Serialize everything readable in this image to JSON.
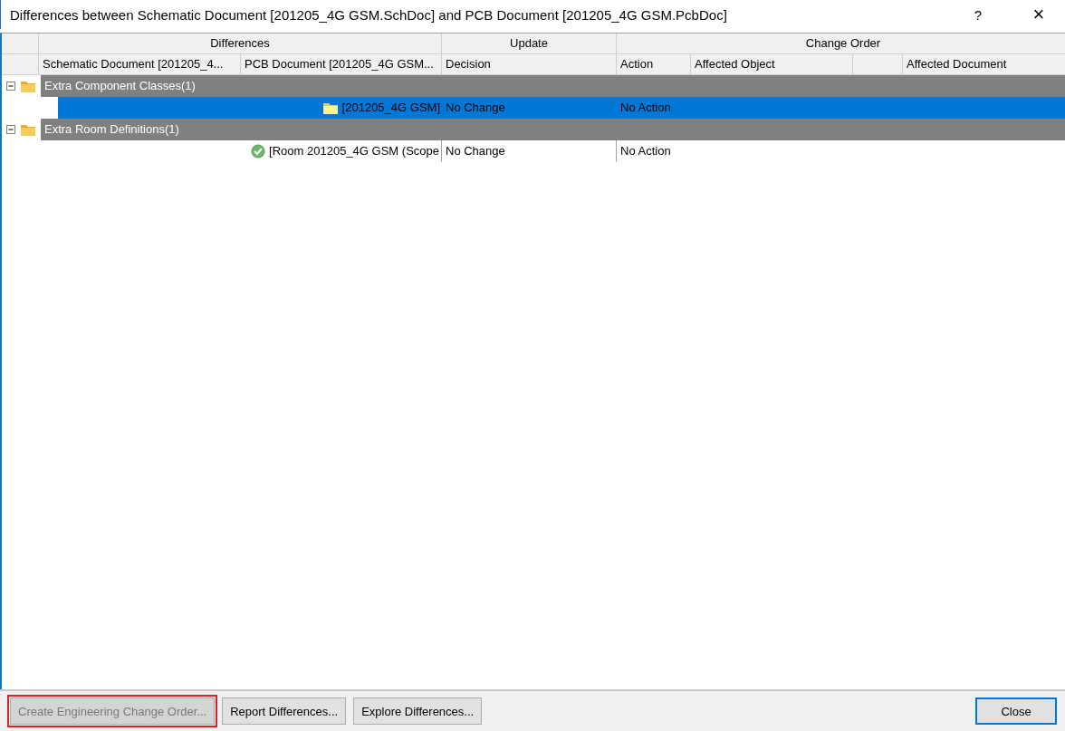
{
  "window": {
    "title": "Differences between Schematic Document [201205_4G GSM.SchDoc] and PCB Document [201205_4G GSM.PcbDoc]",
    "help": "?",
    "close": "×"
  },
  "table": {
    "column_groups": [
      {
        "label": "Differences"
      },
      {
        "label": "Update"
      },
      {
        "label": "Change Order"
      }
    ],
    "columns": [
      "Schematic Document [201205_4...",
      "PCB Document [201205_4G GSM...",
      "Decision",
      "Action",
      "Affected Object",
      "",
      "Affected Document"
    ],
    "rows": [
      {
        "kind": "group",
        "label": "Extra Component Classes(1)",
        "expanded": true,
        "children": [
          {
            "kind": "item",
            "pcb": "[201205_4G GSM]",
            "decision": "No Change",
            "action": "No Action",
            "selected": true
          }
        ]
      },
      {
        "kind": "group",
        "label": "Extra Room Definitions(1)",
        "expanded": true,
        "children": [
          {
            "kind": "item",
            "pcb": "[Room 201205_4G GSM (Scope",
            "decision": "No Change",
            "action": "No Action",
            "selected": false
          }
        ]
      }
    ]
  },
  "buttons": [
    {
      "label": "Create Engineering Change Order...",
      "disabled": true,
      "highlighted": true,
      "default": false
    },
    {
      "label": "Report Differences...",
      "disabled": false,
      "highlighted": false,
      "default": false
    },
    {
      "label": "Explore Differences...",
      "disabled": false,
      "highlighted": false,
      "default": false
    },
    {
      "label": "Close",
      "disabled": false,
      "highlighted": false,
      "default": true
    }
  ]
}
